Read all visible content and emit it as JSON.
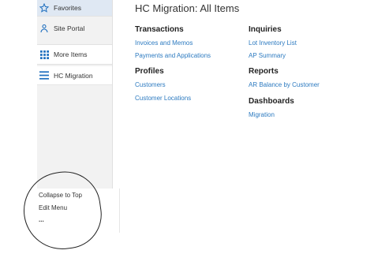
{
  "page_title": "HC Migration: All Items",
  "sidebar": {
    "items": [
      {
        "label": "Favorites",
        "icon": "star-icon"
      },
      {
        "label": "Site Portal",
        "icon": "person-icon"
      },
      {
        "label": "More Items",
        "icon": "grid-icon"
      },
      {
        "label": "HC Migration",
        "icon": "list-icon"
      }
    ],
    "bottom": {
      "collapse_label": "Collapse to Top",
      "edit_label": "Edit Menu",
      "more_label": "..."
    }
  },
  "sections": {
    "transactions": {
      "heading": "Transactions",
      "links": [
        "Invoices and Memos",
        "Payments and Applications"
      ]
    },
    "profiles": {
      "heading": "Profiles",
      "links": [
        "Customers",
        "Customer Locations"
      ]
    },
    "inquiries": {
      "heading": "Inquiries",
      "links": [
        "Lot Inventory List",
        "AP Summary"
      ]
    },
    "reports": {
      "heading": "Reports",
      "links": [
        "AR Balance by Customer"
      ]
    },
    "dashboards": {
      "heading": "Dashboards",
      "links": [
        "Migration"
      ]
    }
  },
  "colors": {
    "link": "#2c7ac0",
    "accent": "#1f6fbf",
    "selected_bg": "#dfe8f3"
  }
}
